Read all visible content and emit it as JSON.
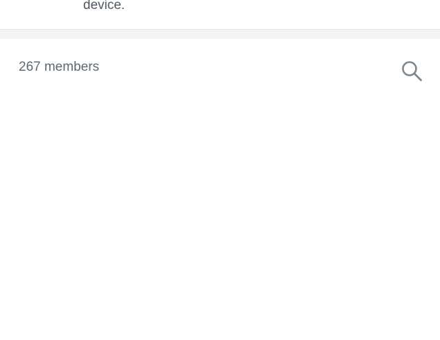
{
  "top_section": {
    "text": "device."
  },
  "members": {
    "count_label": "267 members",
    "search_icon": "search-icon"
  },
  "colors": {
    "text_primary": "#505962",
    "text_secondary": "#5f6972",
    "divider": "#dfe3e8",
    "separator_background": "#f1f3f5",
    "icon": "#7d868e"
  }
}
